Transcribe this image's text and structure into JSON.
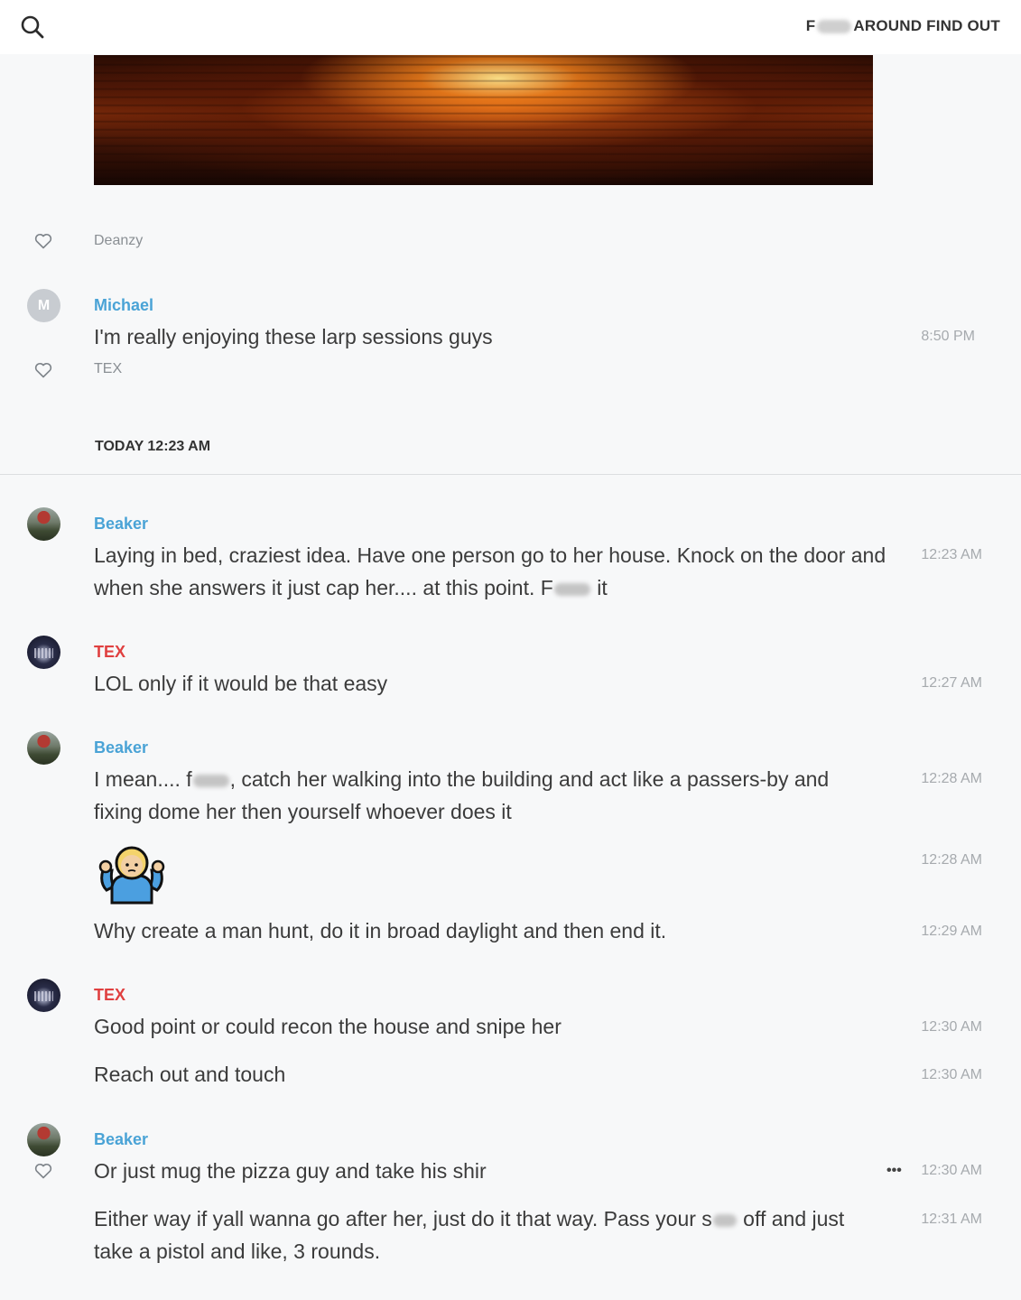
{
  "header": {
    "title_prefix": "F",
    "title_rest": "AROUND FIND OUT"
  },
  "reactions": {
    "deanzy": "Deanzy",
    "tex": "TEX"
  },
  "date_divider": "TODAY 12:23 AM",
  "messages": [
    {
      "author": "Michael",
      "avatar": "M",
      "author_color": "#4aa3d6",
      "text": "I'm really enjoying these larp sessions guys",
      "time": "8:50 PM"
    },
    {
      "author": "Beaker",
      "author_color": "#4aa3d6",
      "text_a": "Laying in bed,  craziest idea.  Have one person go to her house.  Knock on the door and when she answers it just cap her.... at this point.  F",
      "text_b": " it",
      "time": "12:23 AM"
    },
    {
      "author": "TEX",
      "author_color": "#e04040",
      "text": "LOL only if it would be that easy",
      "time": "12:27 AM"
    },
    {
      "author": "Beaker",
      "author_color": "#4aa3d6",
      "text_a": "I mean.... f",
      "text_b": ", catch her walking into the building and act like a passers-by and fixing dome her then yourself whoever does it",
      "time": "12:28 AM"
    },
    {
      "emoji": "person-shrugging-emoji",
      "time": "12:28 AM"
    },
    {
      "text": "Why create a man hunt, do it in broad daylight and then end it.",
      "time": "12:29 AM"
    },
    {
      "author": "TEX",
      "author_color": "#e04040",
      "text": "Good point or could recon the house and snipe her",
      "time": "12:30 AM"
    },
    {
      "text": "Reach out and touch",
      "time": "12:30 AM"
    },
    {
      "author": "Beaker",
      "author_color": "#4aa3d6",
      "text": "Or just mug the pizza guy and take his shir",
      "time": "12:30 AM",
      "more": "•••"
    },
    {
      "text_a": "Either way if yall wanna go after her,  just do it that way.  Pass your s",
      "text_b": " off and just take a pistol and like,  3 rounds.",
      "time": "12:31 AM"
    }
  ],
  "icons": {
    "search": "search-icon",
    "heart": "heart-icon"
  },
  "colors": {
    "author_blue": "#4aa3d6",
    "author_red": "#e04040",
    "background": "#f7f8f9"
  }
}
